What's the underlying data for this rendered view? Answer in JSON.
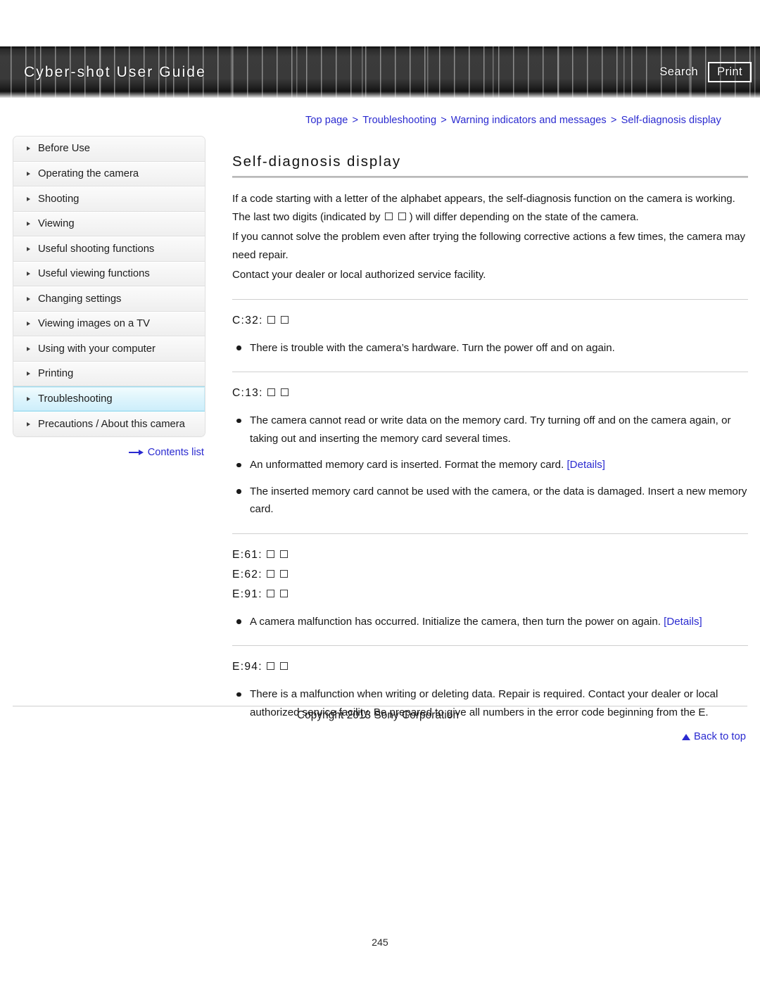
{
  "header": {
    "site_title": "Cyber-shot User Guide",
    "search_label": "Search",
    "print_label": "Print"
  },
  "breadcrumb": {
    "separator": ">",
    "items": [
      {
        "label": "Top page"
      },
      {
        "label": "Troubleshooting"
      },
      {
        "label": "Warning indicators and messages"
      },
      {
        "label": "Self-diagnosis display"
      }
    ]
  },
  "sidebar": {
    "items": [
      {
        "label": "Before Use",
        "active": false
      },
      {
        "label": "Operating the camera",
        "active": false
      },
      {
        "label": "Shooting",
        "active": false
      },
      {
        "label": "Viewing",
        "active": false
      },
      {
        "label": "Useful shooting functions",
        "active": false
      },
      {
        "label": "Useful viewing functions",
        "active": false
      },
      {
        "label": "Changing settings",
        "active": false
      },
      {
        "label": "Viewing images on a TV",
        "active": false
      },
      {
        "label": "Using with your computer",
        "active": false
      },
      {
        "label": "Printing",
        "active": false
      },
      {
        "label": "Troubleshooting",
        "active": true
      },
      {
        "label": "Precautions / About this camera",
        "active": false
      }
    ],
    "contents_list_label": "Contents list"
  },
  "main": {
    "title": "Self-diagnosis display",
    "intro": {
      "line1_a": "If a code starting with a letter of the alphabet appears, the self-diagnosis function on the camera is working. The last two digits (indicated by",
      "line1_b": ") will differ depending on the state of the camera.",
      "line2": "If you cannot solve the problem even after trying the following corrective actions a few times, the camera may need repair.",
      "line3": "Contact your dealer or local authorized service facility."
    },
    "sections": [
      {
        "codes": [
          "C:32:"
        ],
        "bullets": [
          {
            "text": "There is trouble with the camera’s hardware. Turn the power off and on again.",
            "link": null
          }
        ]
      },
      {
        "codes": [
          "C:13:"
        ],
        "bullets": [
          {
            "text": "The camera cannot read or write data on the memory card. Try turning off and on the camera again, or taking out and inserting the memory card several times.",
            "link": null
          },
          {
            "text": "An unformatted memory card is inserted. Format the memory card.",
            "link": "[Details]"
          },
          {
            "text": "The inserted memory card cannot be used with the camera, or the data is damaged. Insert a new memory card.",
            "link": null
          }
        ]
      },
      {
        "codes": [
          "E:61:",
          "E:62:",
          "E:91:"
        ],
        "bullets": [
          {
            "text": "A camera malfunction has occurred. Initialize the camera, then turn the power on again.",
            "link": "[Details]"
          }
        ]
      },
      {
        "codes": [
          "E:94:"
        ],
        "bullets": [
          {
            "text": "There is a malfunction when writing or deleting data. Repair is required. Contact your dealer or local authorized service facility. Be prepared to give all numbers in the error code beginning from the E.",
            "link": null
          }
        ]
      }
    ],
    "back_to_top_label": "Back to top"
  },
  "footer": {
    "copyright": "Copyright 2013 Sony Corporation",
    "page_number": "245"
  },
  "colors": {
    "link_blue": "#2a2ad0",
    "active_nav_cyan": "#cdeefb",
    "header_dark": "#3a3a3a"
  }
}
